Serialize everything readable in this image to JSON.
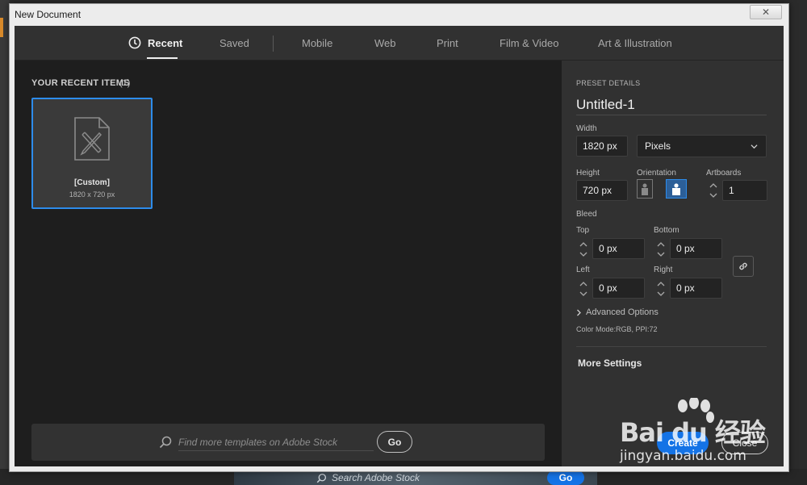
{
  "window": {
    "title": "New Document",
    "close_glyph": "✕"
  },
  "tabs": [
    {
      "label": "Recent",
      "icon": "clock-icon",
      "active": true
    },
    {
      "label": "Saved"
    },
    {
      "label": "Mobile"
    },
    {
      "label": "Web"
    },
    {
      "label": "Print"
    },
    {
      "label": "Film & Video"
    },
    {
      "label": "Art & Illustration"
    }
  ],
  "recent": {
    "heading": "YOUR RECENT ITEMS",
    "count": "(1)",
    "items": [
      {
        "name": "[Custom]",
        "size": "1820 x 720 px",
        "icon": "document-pen-icon"
      }
    ]
  },
  "search": {
    "placeholder": "Find more templates on Adobe Stock",
    "go": "Go"
  },
  "preset": {
    "heading": "PRESET DETAILS",
    "name": "Untitled-1",
    "width_label": "Width",
    "width": "1820 px",
    "unit": "Pixels",
    "height_label": "Height",
    "height": "720 px",
    "orientation_label": "Orientation",
    "artboards_label": "Artboards",
    "artboards": "1",
    "bleed_label": "Bleed",
    "top_label": "Top",
    "top": "0 px",
    "bottom_label": "Bottom",
    "bottom": "0 px",
    "left_label": "Left",
    "left": "0 px",
    "right_label": "Right",
    "right": "0 px",
    "advanced": "Advanced Options",
    "color_mode": "Color Mode:RGB, PPI:72",
    "more_settings": "More Settings",
    "create": "Create",
    "close": "Close"
  },
  "background": {
    "stock_placeholder": "Search Adobe Stock",
    "stock_go": "Go"
  },
  "watermark": {
    "line1": "Bai du 经验",
    "line2": "jingyan.baidu.com"
  },
  "colors": {
    "accent": "#1473e6",
    "selection": "#2d8ceb",
    "panel": "#313131",
    "canvas": "#1e1e1e"
  }
}
